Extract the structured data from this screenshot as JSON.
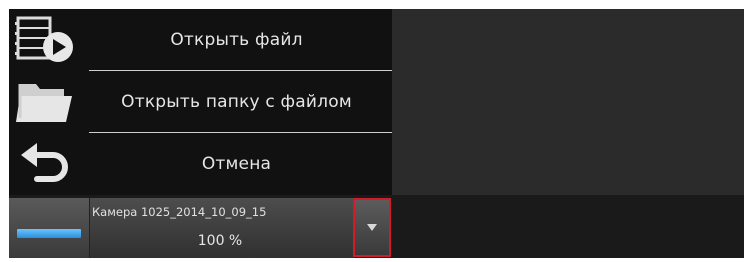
{
  "menu": {
    "items": [
      {
        "label": "Открыть файл",
        "icon": "film-play-icon"
      },
      {
        "label": "Открыть папку с файлом",
        "icon": "folder-open-icon"
      },
      {
        "label": "Отмена",
        "icon": "undo-arrow-icon"
      }
    ]
  },
  "camera": {
    "name": "Камера 1025_2014_10_09_15",
    "zoom": "100 %",
    "dropdown_icon": "chevron-down-icon",
    "tile_color": "#2a8fd8"
  },
  "colors": {
    "highlight_border": "#d21b2a"
  }
}
